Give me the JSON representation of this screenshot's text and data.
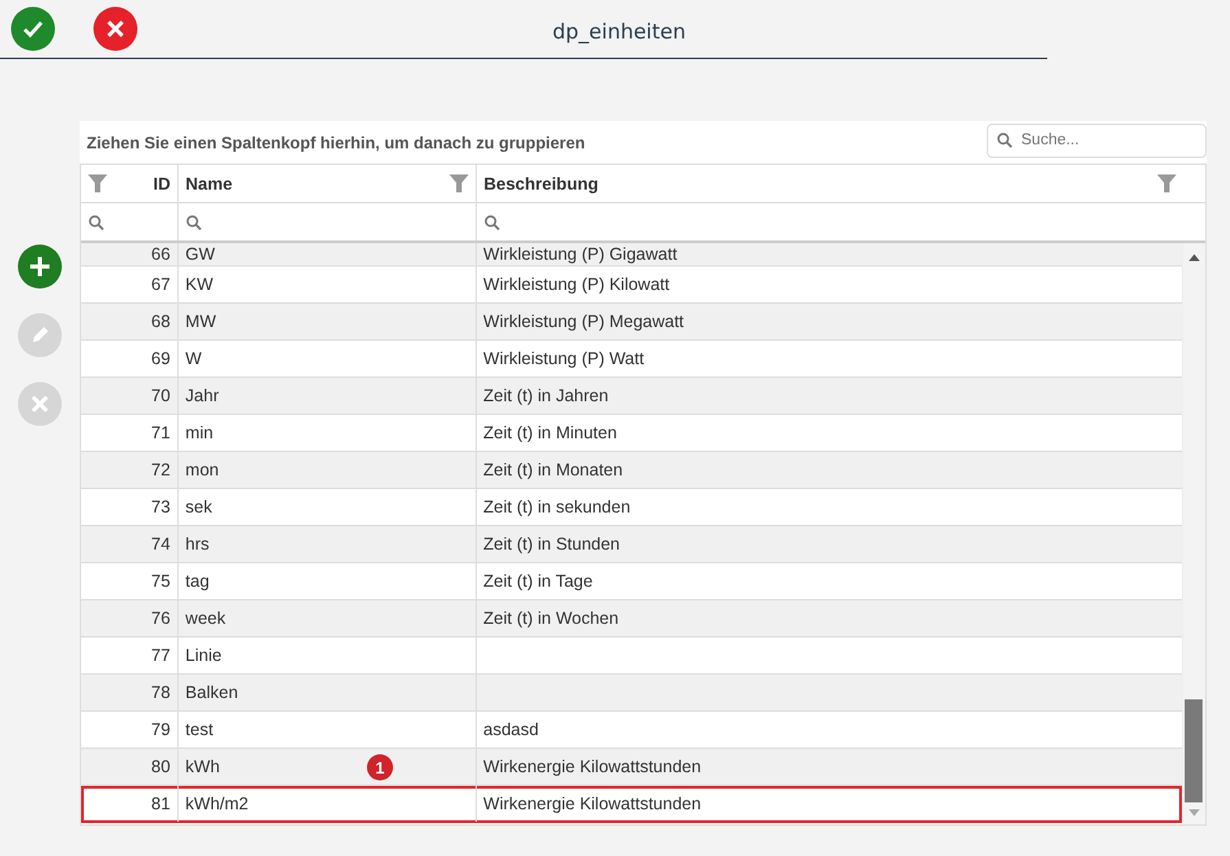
{
  "toolbar": {
    "confirm": {
      "kind": "confirm"
    },
    "cancel": {
      "kind": "cancel"
    },
    "title": "dp_einheiten"
  },
  "side_buttons": [
    {
      "kind": "add",
      "disabled": false
    },
    {
      "kind": "edit",
      "disabled": true
    },
    {
      "kind": "delete",
      "disabled": true
    }
  ],
  "grid": {
    "group_panel": "Ziehen Sie einen Spaltenkopf hierhin, um danach zu gruppieren",
    "search": {
      "placeholder": "Suche..."
    },
    "columns": [
      {
        "label": "ID"
      },
      {
        "label": "Name"
      },
      {
        "label": "Beschreibung"
      }
    ],
    "rows": [
      {
        "id": "66",
        "name": "GW",
        "description": "Wirkleistung (P) Gigawatt",
        "highlighted": false
      },
      {
        "id": "67",
        "name": "KW",
        "description": "Wirkleistung (P) Kilowatt",
        "highlighted": false
      },
      {
        "id": "68",
        "name": "MW",
        "description": "Wirkleistung (P) Megawatt",
        "highlighted": false
      },
      {
        "id": "69",
        "name": "W",
        "description": "Wirkleistung (P) Watt",
        "highlighted": false
      },
      {
        "id": "70",
        "name": "Jahr",
        "description": "Zeit (t) in Jahren",
        "highlighted": false
      },
      {
        "id": "71",
        "name": "min",
        "description": "Zeit (t) in Minuten",
        "highlighted": false
      },
      {
        "id": "72",
        "name": "mon",
        "description": "Zeit (t) in Monaten",
        "highlighted": false
      },
      {
        "id": "73",
        "name": "sek",
        "description": "Zeit (t) in sekunden",
        "highlighted": false
      },
      {
        "id": "74",
        "name": "hrs",
        "description": "Zeit (t) in Stunden",
        "highlighted": false
      },
      {
        "id": "75",
        "name": "tag",
        "description": "Zeit (t) in Tage",
        "highlighted": false
      },
      {
        "id": "76",
        "name": "week",
        "description": "Zeit (t) in Wochen",
        "highlighted": false
      },
      {
        "id": "77",
        "name": "Linie",
        "highlighted": false
      },
      {
        "id": "78",
        "name": "Balken",
        "highlighted": false
      },
      {
        "id": "79",
        "name": "test",
        "description": "asdasd",
        "highlighted": false
      },
      {
        "id": "80",
        "name": "kWh",
        "description": "Wirkenergie Kilowattstunden",
        "highlighted": false,
        "marker": "1"
      },
      {
        "id": "81",
        "name": "kWh/m2",
        "description": "Wirkenergie Kilowattstunden",
        "highlighted": true
      }
    ]
  }
}
